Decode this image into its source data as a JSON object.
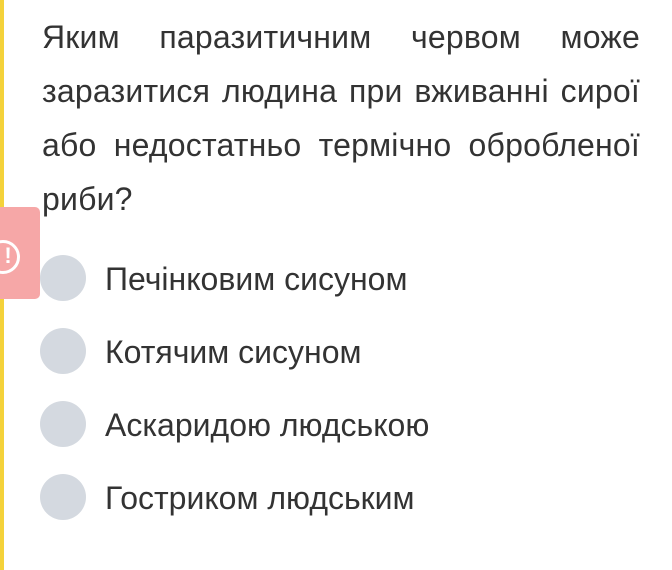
{
  "question": {
    "text": "Яким паразитичним червом може заразитися людина при вживанні сирої або недостатньо термічно обробленої риби?"
  },
  "alert": {
    "icon": "exclamation-circle-icon",
    "glyph": "!",
    "color": "#f6a7a7"
  },
  "accent_color": "#f4d23a",
  "options": [
    {
      "label": "Печінковим сисуном",
      "selected": false
    },
    {
      "label": "Котячим сисуном",
      "selected": false
    },
    {
      "label": "Аскаридою людською",
      "selected": false
    },
    {
      "label": "Гостриком людським",
      "selected": false
    }
  ]
}
